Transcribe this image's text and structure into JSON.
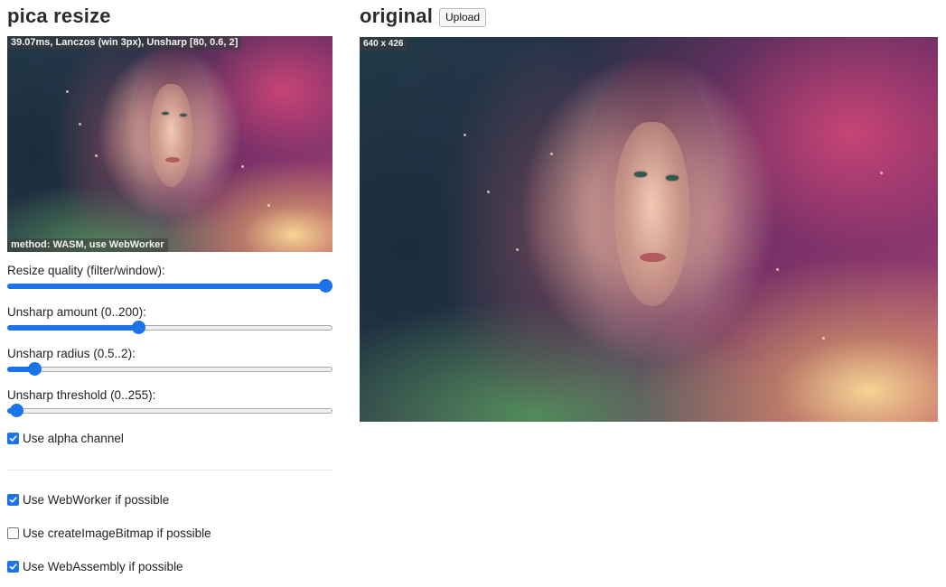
{
  "left": {
    "title": "pica resize",
    "thumbnail": {
      "timing_label": "39.07ms, Lanczos (win 3px), Unsharp [80, 0.6, 2]",
      "method_label": "method: WASM, use WebWorker"
    },
    "controls": {
      "quality": {
        "label": "Resize quality (filter/window):",
        "value_fraction": 1.0
      },
      "unsharp_amount": {
        "label": "Unsharp amount (0..200):",
        "value_fraction": 0.4
      },
      "unsharp_radius": {
        "label": "Unsharp radius (0.5..2):",
        "value_fraction": 0.0667
      },
      "unsharp_threshold": {
        "label": "Unsharp threshold (0..255):",
        "value_fraction": 0.0078
      }
    },
    "checkboxes": {
      "alpha": {
        "label": "Use alpha channel",
        "checked": true
      },
      "webworker": {
        "label": "Use WebWorker if possible",
        "checked": true
      },
      "createimagebitmap": {
        "label": "Use createImageBitmap if possible",
        "checked": false
      },
      "webassembly": {
        "label": "Use WebAssembly if possible",
        "checked": true
      }
    }
  },
  "right": {
    "title": "original",
    "upload_label": "Upload",
    "dims_label": "640 x 426"
  },
  "colors": {
    "accent": "#1a73e8",
    "title": "#2b2b2b",
    "overlay_bg": "rgba(60,60,60,0.55)"
  },
  "icons": {
    "checkmark": "check-icon"
  }
}
